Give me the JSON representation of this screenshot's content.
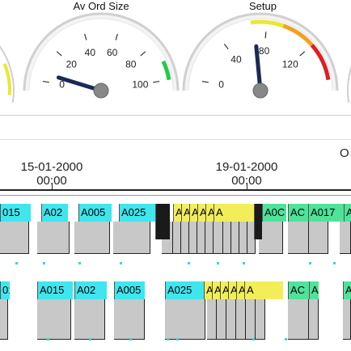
{
  "gauges": [
    {
      "title": "Av Ord Size",
      "ticks": [
        "0",
        "20",
        "40",
        "60",
        "80",
        "100"
      ],
      "value": 5,
      "max": 100
    },
    {
      "title": "Setup",
      "ticks": [
        "0",
        "40",
        "80",
        "120"
      ],
      "value": 70,
      "max": 150
    }
  ],
  "edge_label": "O",
  "timeline": {
    "dates": [
      {
        "date": "15-01-2000",
        "time": "00:00"
      },
      {
        "date": "19-01-2000",
        "time": "00:00"
      }
    ]
  },
  "rows": [
    {
      "bars": [
        {
          "label": "015",
          "color": "cyan"
        },
        {
          "label": "A02",
          "color": "cyan"
        },
        {
          "label": "A005",
          "color": "cyan"
        },
        {
          "label": "A025",
          "color": "cyan"
        },
        {
          "label": "",
          "color": "dark"
        },
        {
          "label": "A",
          "color": "yellow"
        },
        {
          "label": "A",
          "color": "yellow"
        },
        {
          "label": "A",
          "color": "yellow"
        },
        {
          "label": "A",
          "color": "yellow"
        },
        {
          "label": "A",
          "color": "yellow"
        },
        {
          "label": "A",
          "color": "yellow"
        },
        {
          "label": "",
          "color": "dark"
        },
        {
          "label": "A0C",
          "color": "green"
        },
        {
          "label": "AC",
          "color": "green"
        },
        {
          "label": "A017",
          "color": "green"
        },
        {
          "label": "A",
          "color": "green"
        }
      ]
    },
    {
      "bars": [
        {
          "label": "01",
          "color": "cyan"
        },
        {
          "label": "A015",
          "color": "cyan"
        },
        {
          "label": "A02",
          "color": "cyan"
        },
        {
          "label": "A005",
          "color": "cyan"
        },
        {
          "label": "A025",
          "color": "cyan"
        },
        {
          "label": "A",
          "color": "yellow"
        },
        {
          "label": "A",
          "color": "yellow"
        },
        {
          "label": "A",
          "color": "yellow"
        },
        {
          "label": "A",
          "color": "yellow"
        },
        {
          "label": "A",
          "color": "yellow"
        },
        {
          "label": "A",
          "color": "yellow"
        },
        {
          "label": "AC",
          "color": "green"
        },
        {
          "label": "A",
          "color": "green"
        },
        {
          "label": "A",
          "color": "green"
        }
      ]
    }
  ],
  "colors": {
    "cyan": "#3fe6ee",
    "yellow": "#f2ee5a",
    "green": "#4fe39a",
    "dark": "#1a1a1a"
  }
}
